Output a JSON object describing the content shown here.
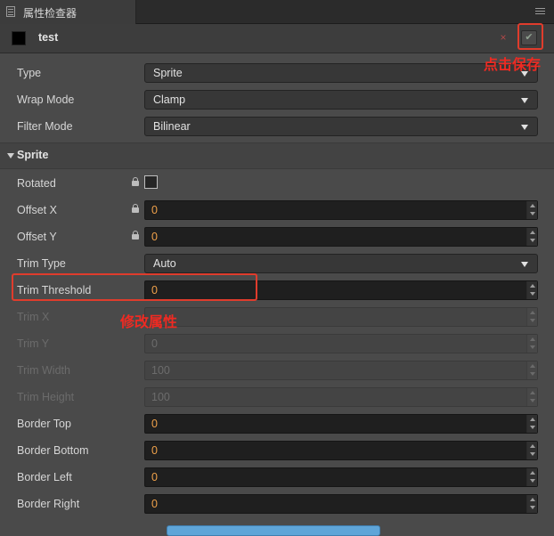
{
  "tab": {
    "title": "属性检查器"
  },
  "asset": {
    "name": "test",
    "swatch_color": "#000000",
    "revert_symbol": "×",
    "apply_symbol": "✔"
  },
  "fields": [
    {
      "label": "Type",
      "value": "Sprite"
    },
    {
      "label": "Wrap Mode",
      "value": "Clamp"
    },
    {
      "label": "Filter Mode",
      "value": "Bilinear"
    }
  ],
  "sprite": {
    "title": "Sprite",
    "rows": [
      {
        "label": "Rotated",
        "checked": false
      },
      {
        "label": "Offset X",
        "value": "0"
      },
      {
        "label": "Offset Y",
        "value": "0"
      },
      {
        "label": "Trim Type",
        "value": "Auto"
      },
      {
        "label": "Trim Threshold",
        "value": "0"
      },
      {
        "label": "Trim X",
        "value": ""
      },
      {
        "label": "Trim Y",
        "value": "0"
      },
      {
        "label": "Trim Width",
        "value": "100"
      },
      {
        "label": "Trim Height",
        "value": "100"
      },
      {
        "label": "Border Top",
        "value": "0"
      },
      {
        "label": "Border Bottom",
        "value": "0"
      },
      {
        "label": "Border Left",
        "value": "0"
      },
      {
        "label": "Border Right",
        "value": "0"
      }
    ]
  },
  "annotations": {
    "save": "点击保存",
    "modify": "修改属性"
  },
  "colors": {
    "accent_value": "#f0a14a",
    "annotation": "#ef2a22",
    "panel": "#4a4a4a"
  }
}
